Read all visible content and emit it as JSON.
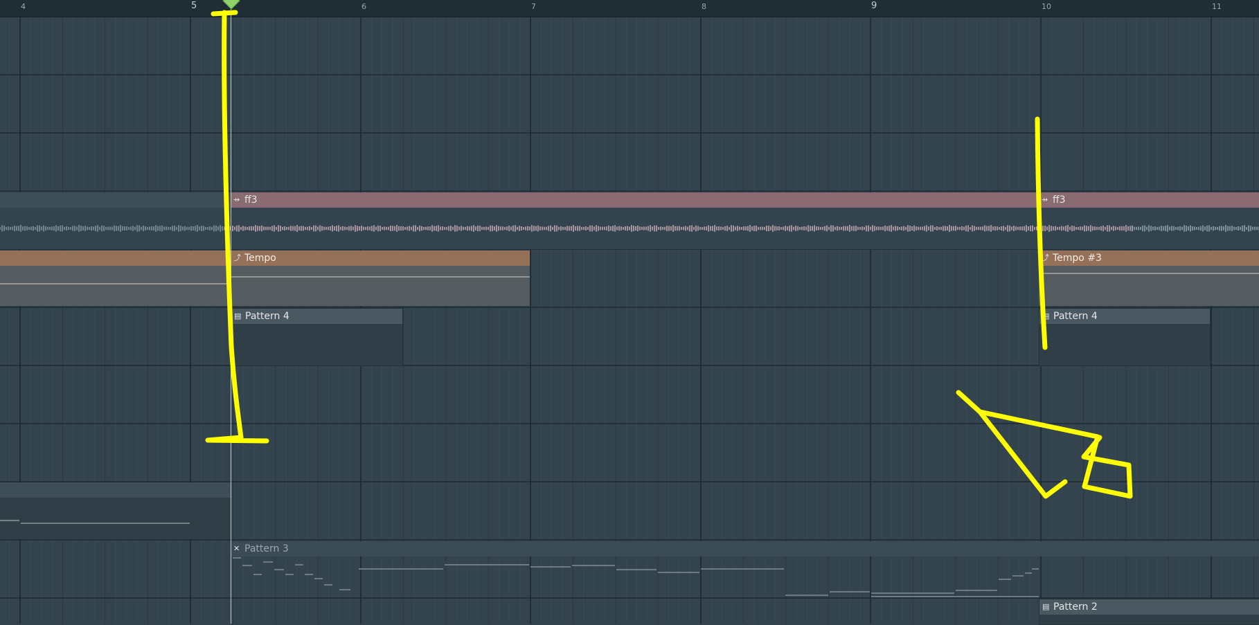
{
  "ruler": {
    "bars": [
      "4",
      "5",
      "6",
      "7",
      "8",
      "9",
      "10",
      "11"
    ],
    "major": [
      "5",
      "9"
    ]
  },
  "clips": {
    "audio_ff3_a": {
      "label": "ff3",
      "icon": "audio-clip-icon"
    },
    "audio_ff3_b": {
      "label": "ff3",
      "icon": "audio-clip-icon"
    },
    "tempo_a": {
      "label": "Tempo",
      "icon": "automation-clip-icon"
    },
    "tempo_b": {
      "label": "Tempo #3",
      "icon": "automation-clip-icon"
    },
    "pattern4_a": {
      "label": "Pattern 4",
      "icon": "pattern-clip-icon"
    },
    "pattern4_b": {
      "label": "Pattern 4",
      "icon": "pattern-clip-icon"
    },
    "pattern3": {
      "label": "Pattern 3",
      "icon": "muted-clip-icon"
    },
    "pattern2": {
      "label": "Pattern 2",
      "icon": "pattern-clip-icon"
    }
  },
  "colors": {
    "background": "#34444e",
    "audio_header": "#8a6b72",
    "tempo_header": "#95715a",
    "pattern_header": "#4a5862",
    "playhead_marker": "#8fd16b",
    "annotation": "#ffff00"
  }
}
